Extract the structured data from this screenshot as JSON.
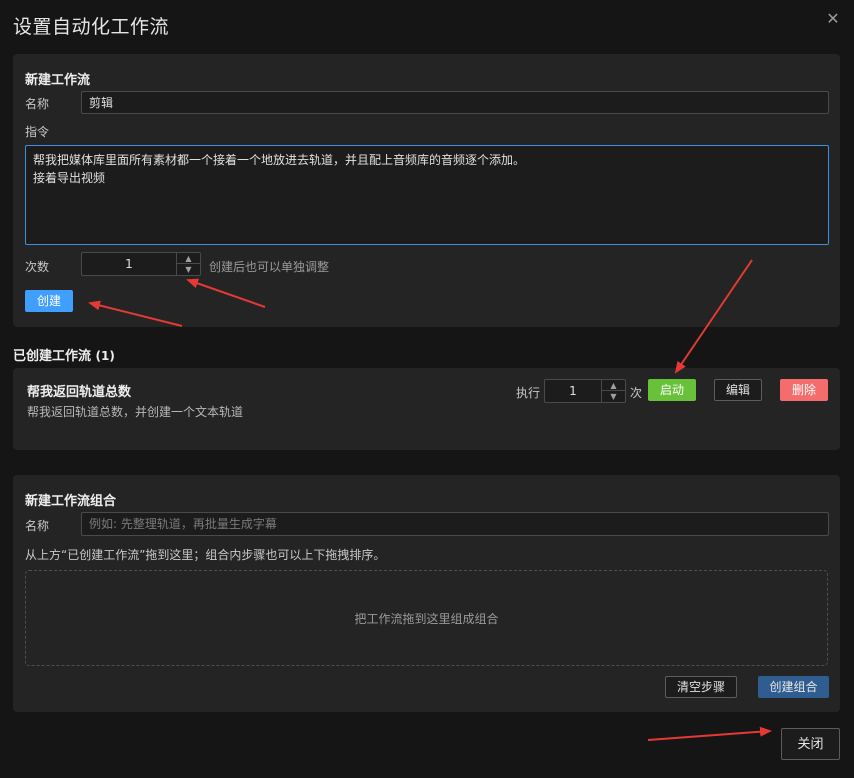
{
  "dialog": {
    "title": "设置自动化工作流",
    "close_glyph": "✕"
  },
  "new_workflow": {
    "title": "新建工作流",
    "name_label": "名称",
    "name_value": "剪辑",
    "instruction_label": "指令",
    "instruction_value": "帮我把媒体库里面所有素材都一个接着一个地放进去轨道，并且配上音频库的音频逐个添加。\n接着导出视频",
    "count_label": "次数",
    "count_value": "1",
    "count_hint": "创建后也可以单独调整",
    "create_label": "创建"
  },
  "created_section": {
    "heading": "已创建工作流",
    "count": "(1)"
  },
  "workflow_item": {
    "title": "帮我返回轨道总数",
    "description": "帮我返回轨道总数，并创建一个文本轨道",
    "run_label": "执行",
    "run_value": "1",
    "run_unit": "次",
    "start_label": "启动",
    "edit_label": "编辑",
    "delete_label": "删除"
  },
  "combo": {
    "title": "新建工作流组合",
    "name_label": "名称",
    "name_placeholder": "例如: 先整理轨道，再批量生成字幕",
    "help_text": "从上方“已创建工作流”拖到这里；组合内步骤也可以上下拖拽排序。",
    "drop_text": "把工作流拖到这里组成组合",
    "clear_label": "清空步骤",
    "create_label": "创建组合"
  },
  "footer": {
    "close_label": "关闭"
  },
  "icons": {
    "stepper_up": "▲",
    "stepper_down": "▼"
  },
  "colors": {
    "primary": "#409eff",
    "success": "#67c23a",
    "danger": "#f56c6c",
    "annotation_arrow": "#e53935"
  }
}
